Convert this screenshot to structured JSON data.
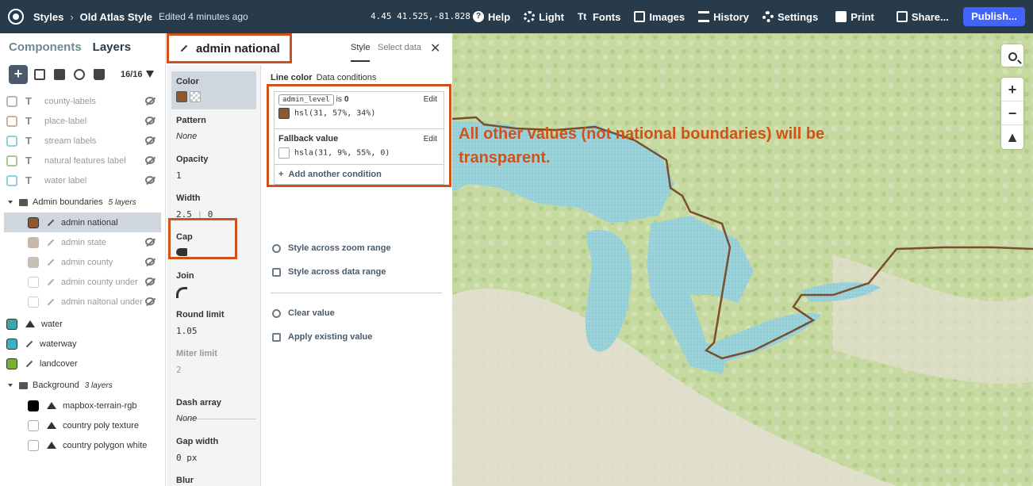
{
  "topbar": {
    "breadcrumb_root": "Styles",
    "style_name": "Old Atlas Style",
    "edited": "Edited 4 minutes ago",
    "coords": "4.45  41.525,-81.828",
    "menu": {
      "help": "Help",
      "light": "Light",
      "fonts": "Fonts",
      "images": "Images",
      "history": "History",
      "settings": "Settings",
      "print": "Print",
      "share": "Share..."
    },
    "publish": "Publish..."
  },
  "left": {
    "tab_components": "Components",
    "tab_layers": "Layers",
    "layer_count": "16/16",
    "layers": [
      {
        "label": "county-labels",
        "swatch": "#c8b4a0"
      },
      {
        "label": "place-label",
        "swatch": "#c8b4a0"
      },
      {
        "label": "stream labels",
        "swatch": "#8fd0dc"
      },
      {
        "label": "natural features label",
        "swatch": "#a8c890"
      },
      {
        "label": "water label",
        "swatch": "#8fd0dc"
      }
    ],
    "group_admin": {
      "label": "Admin boundaries",
      "count": "5 layers"
    },
    "admin_layers": [
      {
        "label": "admin national",
        "swatch": "#8a5934"
      },
      {
        "label": "admin state",
        "swatch": "#c8b8ac"
      },
      {
        "label": "admin county",
        "swatch": "#c8c0b4"
      },
      {
        "label": "admin county under",
        "swatch": "#ffffff"
      },
      {
        "label": "admin naitonal under",
        "swatch": "#ffffff"
      }
    ],
    "other_layers": [
      {
        "label": "water",
        "swatch": "#3aa6a8"
      },
      {
        "label": "waterway",
        "swatch": "#3ab0c8"
      },
      {
        "label": "landcover",
        "swatch": "#7ab030"
      }
    ],
    "group_background": {
      "label": "Background",
      "count": "3 layers"
    },
    "background_layers": [
      {
        "label": "mapbox-terrain-rgb",
        "swatch": "#000000"
      },
      {
        "label": "country poly texture",
        "swatch": "#ffffff"
      },
      {
        "label": "country polygon white",
        "swatch": "#ffffff"
      }
    ]
  },
  "props": {
    "title": "admin national",
    "tab_style": "Style",
    "tab_select": "Select data",
    "color": "Color",
    "pattern": "Pattern",
    "pattern_val": "None",
    "opacity": "Opacity",
    "opacity_val": "1",
    "width": "Width",
    "width_val": "2.5",
    "width_val2": "0",
    "cap": "Cap",
    "join": "Join",
    "round_limit": "Round limit",
    "round_limit_val": "1.05",
    "miter_limit": "Miter limit",
    "miter_limit_val": "2",
    "dash_array": "Dash array",
    "dash_array_val": "None",
    "gap_width": "Gap width",
    "gap_width_val": "0 px",
    "blur": "Blur"
  },
  "conditions": {
    "line_color": "Line color",
    "data_conditions": "Data conditions",
    "cond_field": "admin_level",
    "cond_op": "is",
    "cond_val": "0",
    "cond_color": "hsl(31, 57%, 34%)",
    "cond_swatch": "#8a5934",
    "edit": "Edit",
    "fallback": "Fallback value",
    "fallback_color": "hsla(31, 9%, 55%, 0)",
    "add_condition": "Add another condition",
    "style_zoom": "Style across zoom range",
    "style_data": "Style across data range",
    "clear_value": "Clear value",
    "apply_existing": "Apply existing value"
  },
  "map": {
    "annotation": "All other values (not national boundaries) will be transparent.",
    "water_color": "#9cd3db",
    "land_color": "#c5d9a0",
    "boundary_color": "#7a4e2c"
  }
}
